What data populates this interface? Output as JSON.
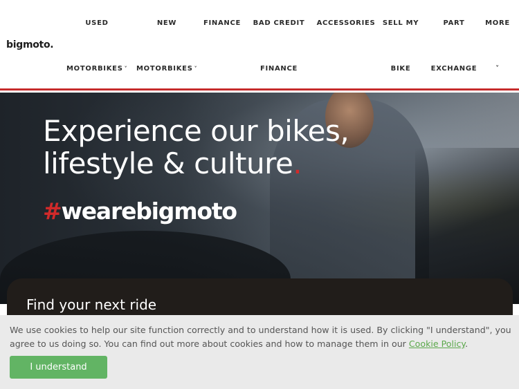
{
  "brand": {
    "logo_text": "bigmoto",
    "logo_dot": "."
  },
  "nav": {
    "items": [
      {
        "top": "USED",
        "bottom": "MOTORBIKES",
        "chevron": "˅"
      },
      {
        "top": "NEW",
        "bottom": "MOTORBIKES",
        "chevron": "˅"
      },
      {
        "top": "FINANCE",
        "bottom": ""
      },
      {
        "top": "BAD CREDIT",
        "bottom": "FINANCE"
      },
      {
        "top": "ACCESSORIES",
        "bottom": ""
      },
      {
        "top": "SELL MY",
        "bottom": "BIKE"
      },
      {
        "top": "PART",
        "bottom": "EXCHANGE"
      },
      {
        "top": "MORE",
        "bottom": "",
        "chevron": "˅"
      }
    ]
  },
  "hero": {
    "title_line1": "Experience our bikes,",
    "title_line2": "lifestyle & culture",
    "title_dot": ".",
    "hashtag_symbol": "#",
    "hashtag_text": "wearebigmoto"
  },
  "ride_search": {
    "title": "Find your next ride"
  },
  "cookie": {
    "text_before_link": "We use cookies to help our site function correctly and to understand how it is used. By clicking \"I understand\", you agree to us doing so. You can find out more about cookies and how to manage them in our ",
    "link_text": "Cookie Policy",
    "text_after_link": ".",
    "button_label": "I understand"
  },
  "colors": {
    "accent_red": "#d12a2a",
    "cookie_button": "#62b464",
    "cookie_link": "#5aa84a"
  }
}
